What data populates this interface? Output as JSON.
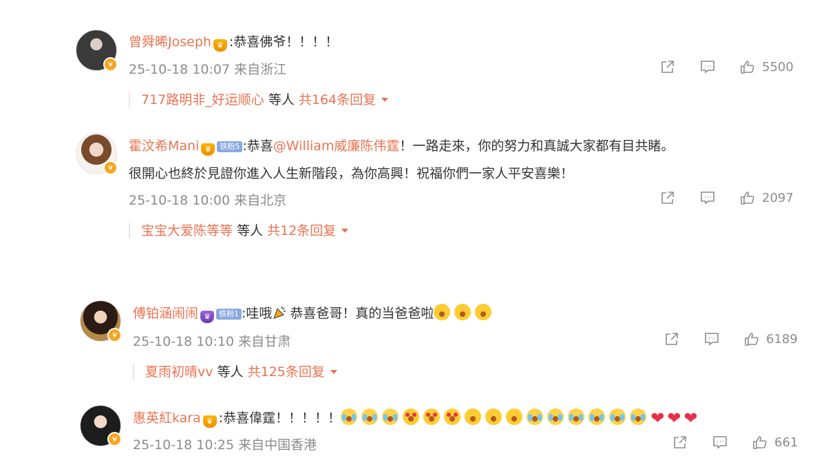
{
  "comments": [
    {
      "username": "曾舜晞Joseph",
      "crown_glyph": "♛",
      "text": ":恭喜佛爷！！！！",
      "timestamp": "25-10-18 10:07",
      "location": "来自浙江",
      "likes": "5500",
      "reply_names": "717路明非_好运顺心",
      "reply_middle": "等人",
      "reply_total": "共164条回复"
    },
    {
      "username": "霍汶希Mani",
      "crown_glyph": "♛",
      "fan_badge": "铁粉5",
      "text_prefix": ":恭喜",
      "mention": "@William威廉陈伟霆",
      "text_suffix": "！一路走來，你的努力和真誠大家都有目共睹。",
      "text_line2": "很開心也終於見證你進入人生新階段，為你高興！祝福你們一家人平安喜樂！",
      "timestamp": "25-10-18 10:00",
      "location": "来自北京",
      "likes": "2097",
      "reply_names": "宝宝大爱陈等等",
      "reply_middle": "等人",
      "reply_total": "共12条回复"
    },
    {
      "username": "傅铂涵闹闹",
      "crown_glyph": "♛",
      "fan_badge": "铁粉1",
      "text_prefix": ":哇哦",
      "text_mid": "恭喜爸哥！真的当爸爸啦",
      "timestamp": "25-10-18 10:10",
      "location": "来自甘肃",
      "likes": "6189",
      "reply_names": "夏雨初晴vv",
      "reply_middle": "等人",
      "reply_total": "共125条回复"
    },
    {
      "username": "惠英紅kara",
      "crown_glyph": "♛",
      "text": ":恭喜偉霆！！！！！",
      "timestamp": "25-10-18 10:25",
      "location": "来自中国香港",
      "likes": "661",
      "heart_glyph": "❤"
    }
  ],
  "verified_glyph": "v",
  "icons": [
    "share-icon",
    "comment-icon",
    "like-icon",
    "verified-icon",
    "crown-icon",
    "party-popper-icon",
    "surprised-emoji",
    "heart-eyes-emoji",
    "crying-emoji",
    "heart-emoji"
  ],
  "colors": {
    "accent": "#eb7350",
    "meta": "#8c8c8c",
    "text": "#333333"
  }
}
